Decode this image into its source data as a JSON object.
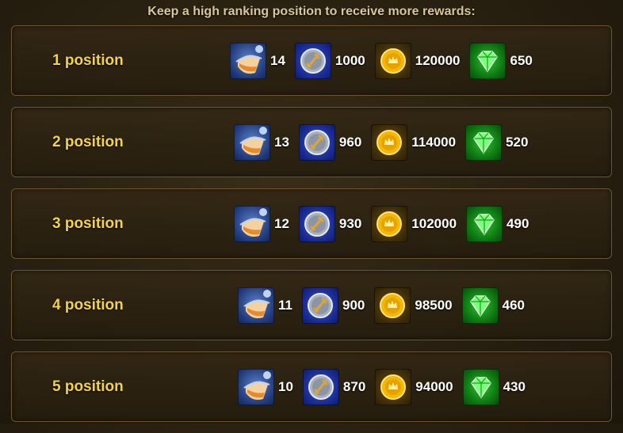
{
  "header": {
    "title": "Keep a high ranking position to receive more rewards:"
  },
  "rows": [
    {
      "position": "1 position",
      "potion": "14",
      "medal": "1000",
      "gold": "120000",
      "emerald": "650"
    },
    {
      "position": "2 position",
      "potion": "13",
      "medal": "960",
      "gold": "114000",
      "emerald": "520"
    },
    {
      "position": "3 position",
      "potion": "12",
      "medal": "930",
      "gold": "102000",
      "emerald": "490"
    },
    {
      "position": "4 position",
      "potion": "11",
      "medal": "900",
      "gold": "98500",
      "emerald": "460"
    },
    {
      "position": "5 position",
      "potion": "10",
      "medal": "870",
      "gold": "94000",
      "emerald": "430"
    }
  ],
  "icons": {
    "potion": "potion-icon",
    "medal": "sword-medal-icon",
    "gold": "gold-coin-icon",
    "emerald": "emerald-icon"
  },
  "colors": {
    "position_text": "#f3d34a",
    "header_text": "#d9c69a",
    "row_border": "#6b5630"
  }
}
